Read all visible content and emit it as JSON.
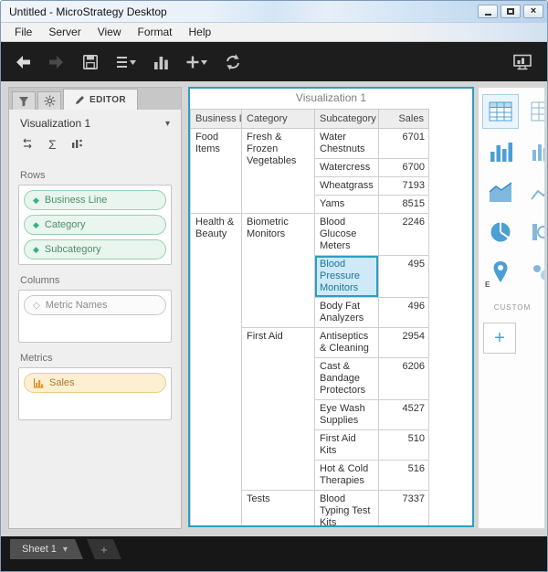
{
  "colors": {
    "accent_teal": "#2b9fc0",
    "selection_fill": "#cfe9f6",
    "attribute_green": "#35b285",
    "metric_amber": "#e6962e",
    "gallery_blue": "#4a9fd4",
    "toolbar_bg": "#1d1d1d"
  },
  "window": {
    "title": "Untitled - MicroStrategy Desktop",
    "controls": [
      "minimize",
      "maximize",
      "close"
    ]
  },
  "menu": {
    "items": [
      "File",
      "Server",
      "View",
      "Format",
      "Help"
    ]
  },
  "toolbar": {
    "icons": [
      "back",
      "forward",
      "save",
      "add-data",
      "insert-visualization",
      "insert",
      "refresh",
      "presentation-mode"
    ]
  },
  "editor": {
    "tab_label": "EDITOR",
    "side_tabs": [
      "filter",
      "properties"
    ],
    "visualization_selector": "Visualization 1",
    "tool_icons": [
      "swap-rows-columns",
      "totals",
      "visualization-options"
    ],
    "rows": {
      "label": "Rows",
      "items": [
        "Business Line",
        "Category",
        "Subcategory"
      ]
    },
    "columns": {
      "label": "Columns",
      "items": [
        "Metric Names"
      ]
    },
    "metrics": {
      "label": "Metrics",
      "items": [
        "Sales"
      ]
    }
  },
  "viz": {
    "title": "Visualization 1",
    "table": {
      "headers": {
        "business_line": "Business Line",
        "category": "Category",
        "subcategory": "Subcategory",
        "sales": "Sales"
      },
      "rows": [
        {
          "bl": "Food Items",
          "cat": "Fresh & Frozen Vegetables",
          "sub": "Water Chestnuts",
          "sales": "6701"
        },
        {
          "sub": "Watercress",
          "sales": "6700"
        },
        {
          "sub": "Wheatgrass",
          "sales": "7193"
        },
        {
          "sub": "Yams",
          "sales": "8515"
        },
        {
          "bl": "Health & Beauty",
          "cat": "Biometric Monitors",
          "sub": "Blood Glucose Meters",
          "sales": "2246"
        },
        {
          "sub": "Blood Pressure Monitors",
          "sales": "495",
          "selected": true
        },
        {
          "sub": "Body Fat Analyzers",
          "sales": "496"
        },
        {
          "cat": "First Aid",
          "sub": "Antiseptics & Cleaning",
          "sales": "2954"
        },
        {
          "sub": "Cast & Bandage Protectors",
          "sales": "6206"
        },
        {
          "sub": "Eye Wash Supplies",
          "sales": "4527"
        },
        {
          "sub": "First Aid Kits",
          "sales": "510"
        },
        {
          "sub": "Hot & Cold Therapies",
          "sales": "516"
        },
        {
          "cat": "Tests",
          "sub": "Blood Typing Test Kits",
          "sales": "7337"
        }
      ]
    }
  },
  "gallery": {
    "icons": [
      "grid",
      "bar-chart",
      "area-chart",
      "pie-chart",
      "map"
    ],
    "custom_label": "CUSTOM",
    "add_custom": "+"
  },
  "sheets": {
    "active_tab": "Sheet 1",
    "add_tab": "+"
  }
}
